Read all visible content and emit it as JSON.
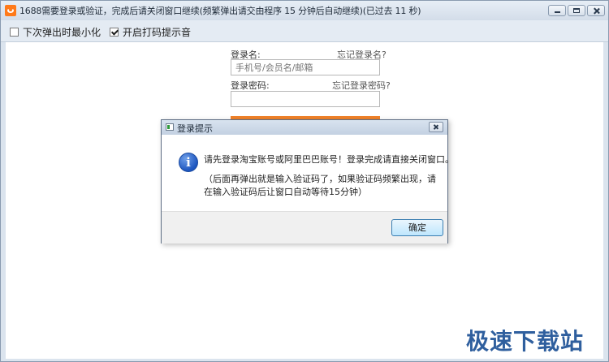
{
  "window": {
    "title": "1688需要登录或验证，完成后请关闭窗口继续(频繁弹出请交由程序 15 分钟后自动继续)(已过去 11 秒)"
  },
  "options": [
    {
      "label": "下次弹出时最小化",
      "checked": false
    },
    {
      "label": "开启打码提示音",
      "checked": true
    }
  ],
  "login": {
    "username_label": "登录名:",
    "forgot_username": "忘记登录名?",
    "username_placeholder": "手机号/会员名/邮箱",
    "password_label": "登录密码:",
    "forgot_password": "忘记登录密码?",
    "accent_color": "#f0822a"
  },
  "dialog": {
    "title": "登录提示",
    "message_line1": "请先登录淘宝账号或阿里巴巴账号！登录完成请直接关闭窗口。",
    "message_line2": "（后面再弹出就是输入验证码了，如果验证码频繁出现，请在输入验证码后让窗口自动等待15分钟）",
    "ok_label": "确定",
    "icon": "info-icon"
  },
  "watermark": "极速下载站"
}
